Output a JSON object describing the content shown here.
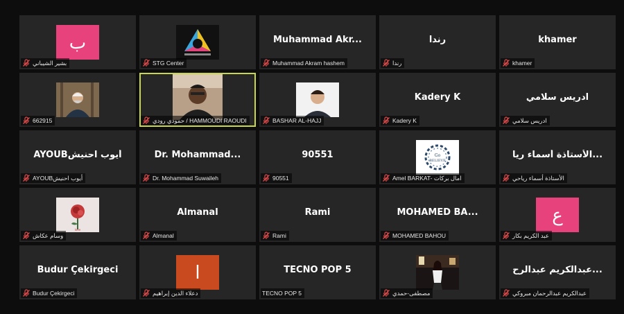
{
  "meeting": {
    "tiles": [
      {
        "label": "بشير الشيباني",
        "big": "",
        "kind": "letter",
        "letter": "ب",
        "color": "#e8427c"
      },
      {
        "label": "STG Center",
        "big": "",
        "kind": "logo"
      },
      {
        "label": "Muhammad Akram hashem",
        "big": "Muhammad Akr...",
        "kind": "name"
      },
      {
        "label": "رندا",
        "big": "رندا",
        "kind": "name"
      },
      {
        "label": "khamer",
        "big": "khamer",
        "kind": "name"
      },
      {
        "label": "662915",
        "big": "",
        "kind": "photo-man"
      },
      {
        "label": "حمودي رودي / HAMMOUDI RAOUDI",
        "big": "",
        "kind": "video",
        "speaking": true
      },
      {
        "label": "BASHAR AL-HAJJ",
        "big": "",
        "kind": "photo-young"
      },
      {
        "label": "Kadery K",
        "big": "Kadery K",
        "kind": "name"
      },
      {
        "label": "ادريس سلامي",
        "big": "ادريس سلامي",
        "kind": "name"
      },
      {
        "label": "AYOUBأيوب احنيش",
        "big": "AYOUBأيوب احنيش",
        "kind": "name"
      },
      {
        "label": "Dr. Mohammad Suwaileh",
        "big": "Dr. Mohammad...",
        "kind": "name"
      },
      {
        "label": "90551",
        "big": "90551",
        "kind": "name"
      },
      {
        "label": "Amel BARKAT- امال بركات",
        "big": "",
        "kind": "photo-wreath"
      },
      {
        "label": "الأستاذة أسماء رياحي",
        "big": "الأستاذة أسماء ريا...",
        "kind": "name"
      },
      {
        "label": "وسام عكاش",
        "big": "",
        "kind": "photo-rose"
      },
      {
        "label": "Almanal",
        "big": "Almanal",
        "kind": "name"
      },
      {
        "label": "Rami",
        "big": "Rami",
        "kind": "name"
      },
      {
        "label": "MOHAMED BAHOU",
        "big": "MOHAMED BA...",
        "kind": "name"
      },
      {
        "label": "عبد الكريم بكار",
        "big": "",
        "kind": "letter",
        "letter": "ع",
        "color": "#e8427c"
      },
      {
        "label": "Budur Çekirgeci",
        "big": "Budur Çekirgeci",
        "kind": "name"
      },
      {
        "label": "دعلاء الدين إبراهيم",
        "big": "",
        "kind": "letter",
        "letter": "ا",
        "color": "#c94a1e"
      },
      {
        "label": "TECNO POP 5",
        "big": "TECNO POP 5",
        "kind": "name",
        "no_mic": true
      },
      {
        "label": "مصطفى-حمدي",
        "big": "",
        "kind": "photo-girl"
      },
      {
        "label": "عبدالكريم عبدالرحمان مبروكي",
        "big": "عبدالكريم عبدالرح...",
        "kind": "name"
      }
    ]
  }
}
